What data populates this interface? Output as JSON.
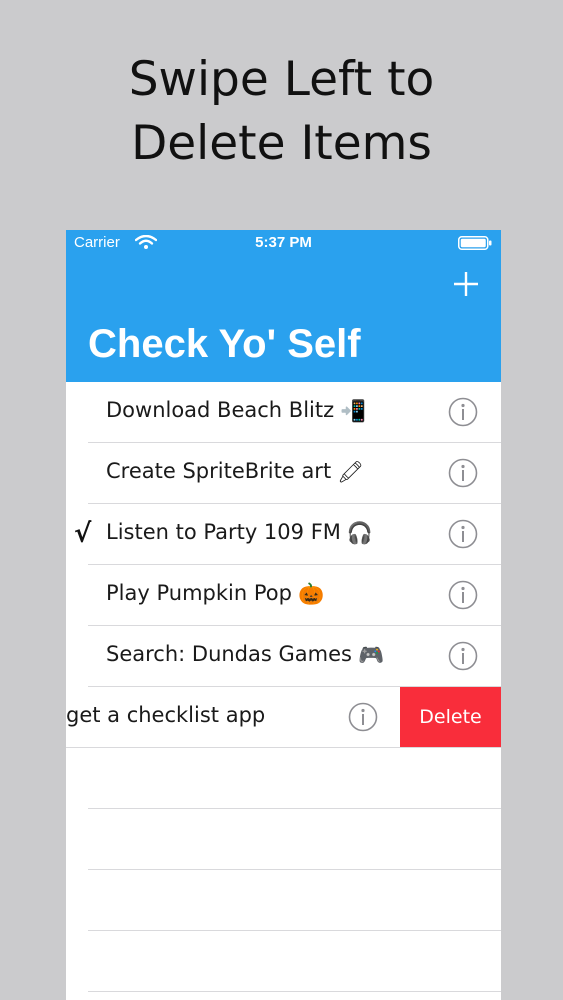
{
  "caption": {
    "line1": "Swipe Left to",
    "line2": "Delete Items"
  },
  "status_bar": {
    "carrier": "Carrier",
    "time": "5:37 PM",
    "icons": [
      "wifi-icon",
      "battery-icon"
    ]
  },
  "nav": {
    "title": "Check Yo' Self",
    "add_icon": "plus-icon"
  },
  "colors": {
    "nav_background": "#2aa1ee",
    "delete_background": "#f92d3b",
    "info_icon": "#8e8e93"
  },
  "items": [
    {
      "label": "Download Beach Blitz",
      "emoji": "📲",
      "checked": false
    },
    {
      "label": "Create SpriteBrite art",
      "emoji": "🖍",
      "checked": false
    },
    {
      "label": "Listen to Party 109 FM",
      "emoji": "🎧",
      "checked": true,
      "check_mark": "√"
    },
    {
      "label": "Play Pumpkin Pop",
      "emoji": "🎃",
      "checked": false
    },
    {
      "label": "Search: Dundas Games",
      "emoji": "🎮",
      "checked": false
    }
  ],
  "swiped_item": {
    "label": "get a checklist app",
    "delete_label": "Delete"
  }
}
